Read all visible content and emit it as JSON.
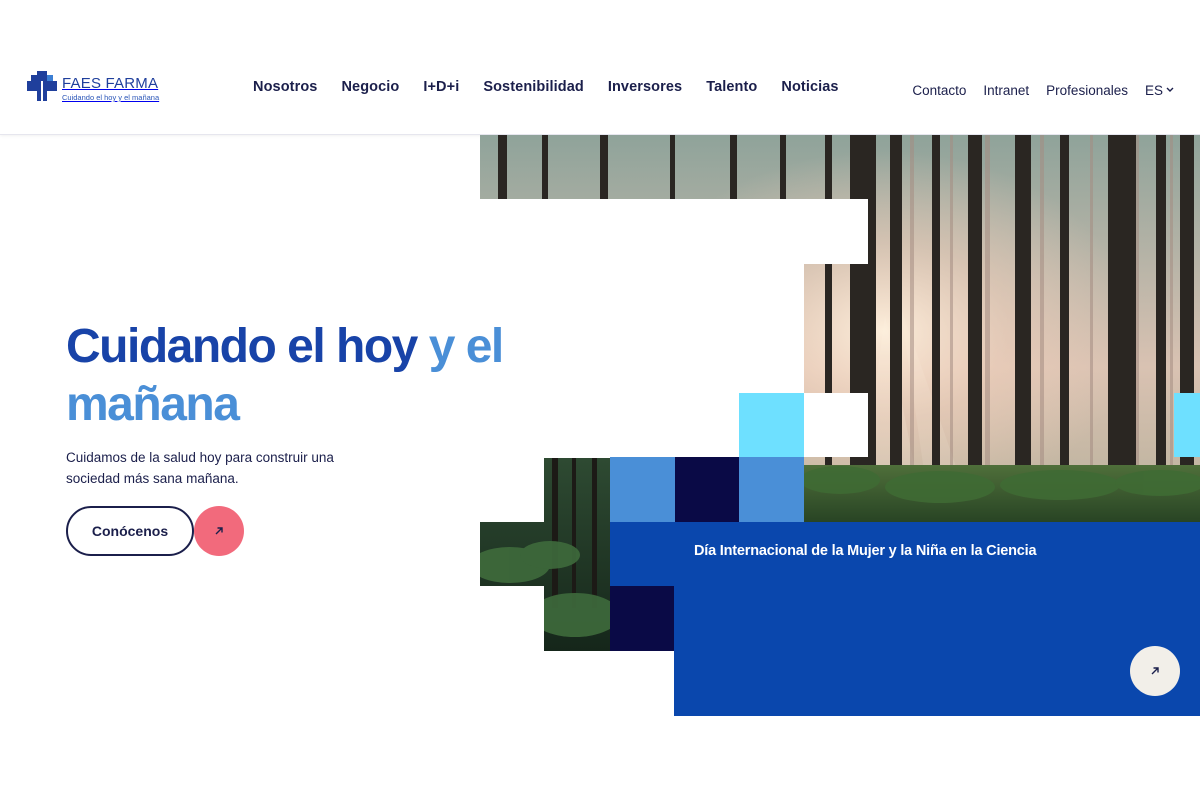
{
  "brand": {
    "name": "FAES FARMA",
    "tagline": "Cuidando el hoy y el mañana"
  },
  "nav": {
    "items": [
      "Nosotros",
      "Negocio",
      "I+D+i",
      "Sostenibilidad",
      "Inversores",
      "Talento",
      "Noticias"
    ]
  },
  "utility": {
    "contact": "Contacto",
    "intranet": "Intranet",
    "professionals": "Profesionales",
    "language": "ES"
  },
  "hero": {
    "title_part1": "Cuidando el hoy",
    "title_part2": "y el",
    "title_part3": "mañana",
    "subtitle": "Cuidamos de la salud hoy para construir una sociedad más sana mañana.",
    "cta_label": "Conócenos"
  },
  "news": {
    "title": "Día Internacional de la Mujer y la Niña en la Ciencia"
  },
  "icons": {
    "logo": "medical-cross-icon",
    "cta_arrow": "arrow-up-right-icon",
    "news_arrow": "arrow-up-right-icon",
    "language": "chevron-down-icon"
  },
  "colors": {
    "brand_blue": "#1843a8",
    "light_blue": "#4a8fd7",
    "navy": "#1b1f4b",
    "accent_pink": "#f26a7c",
    "card_blue": "#0a47ad",
    "cyan": "#6ee0ff",
    "dark_navy": "#0a0a46"
  }
}
